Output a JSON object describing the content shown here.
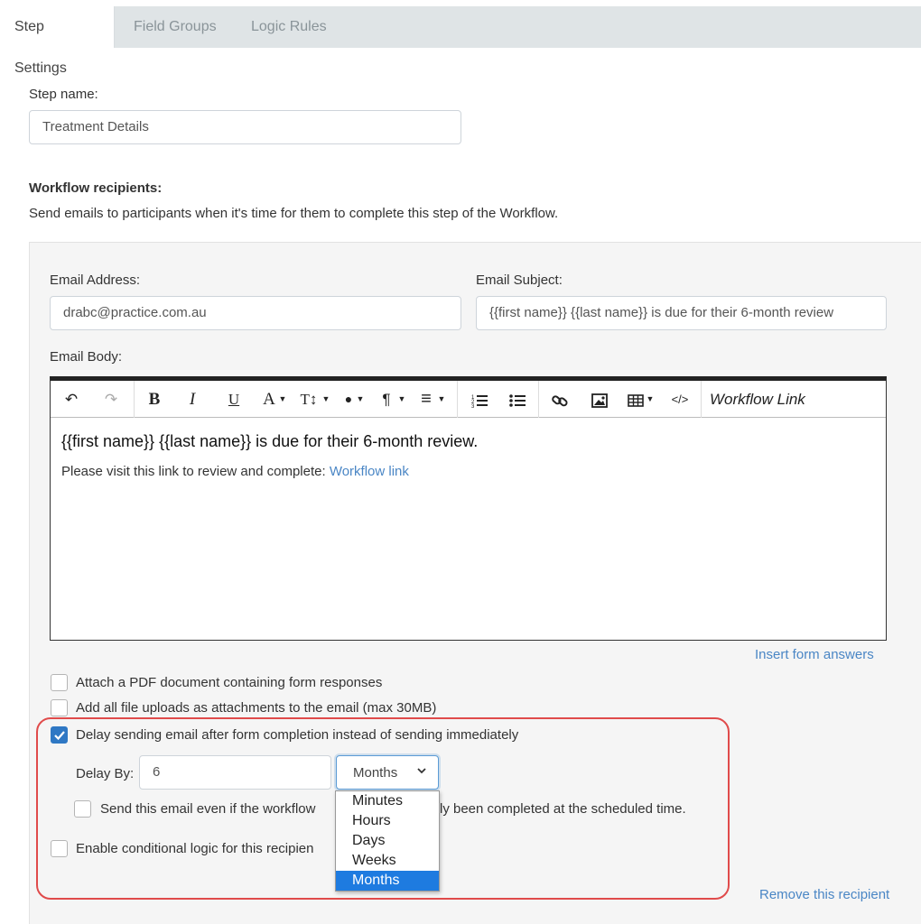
{
  "tabs": [
    {
      "label": "Step Settings"
    },
    {
      "label": "Field Groups"
    },
    {
      "label": "Logic Rules"
    }
  ],
  "step_name": {
    "label": "Step name:",
    "value": "Treatment Details"
  },
  "recipients": {
    "heading": "Workflow recipients:",
    "description": "Send emails to participants when it's time for them to complete this step of the Workflow."
  },
  "email": {
    "address_label": "Email Address:",
    "address_value": "drabc@practice.com.au",
    "subject_label": "Email Subject:",
    "subject_value": "{{first name}} {{last name}} is due for their 6-month review",
    "body_label": "Email Body:"
  },
  "toolbar": {
    "undo": "↶",
    "redo": "↷",
    "bold": "B",
    "italic": "I",
    "underline": "U",
    "font_color": "A",
    "font_size": "T↕",
    "highlight": "●",
    "paragraph": "¶",
    "align": "≡",
    "code": "</>",
    "workflow_link": "Workflow Link"
  },
  "editor": {
    "title_line": "{{first name}} {{last name}} is due for their 6-month review.",
    "body_prefix": "Please visit this link to review and complete: ",
    "body_link": "Workflow link"
  },
  "insert_form_answers": "Insert form answers",
  "options": {
    "attach_pdf": "Attach a PDF document containing form responses",
    "add_uploads": "Add all file uploads as attachments to the email (max 30MB)",
    "delay_sending": "Delay sending email after form completion instead of sending immediately",
    "send_even_prefix": "Send this email even if the workflow",
    "send_even_suffix": "ly been completed at the scheduled time.",
    "conditional_logic": "Enable conditional logic for this recipien"
  },
  "delay": {
    "label": "Delay By:",
    "value": "6",
    "unit_selected": "Months",
    "unit_options": [
      "Minutes",
      "Hours",
      "Days",
      "Weeks",
      "Months"
    ]
  },
  "remove_recipient": "Remove this recipient",
  "colors": {
    "accent": "#2f78c4",
    "link": "#4a86c5",
    "highlight_border": "#e04b4b",
    "selected_option": "#1e7be0"
  }
}
